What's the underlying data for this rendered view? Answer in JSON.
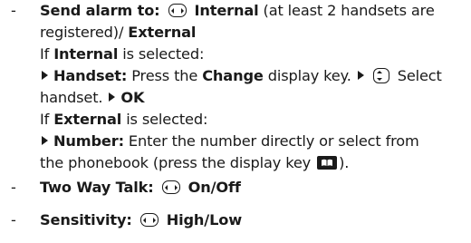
{
  "bullet": "-",
  "items": {
    "send_alarm": {
      "label": "Send alarm to:",
      "internal": "Internal",
      "internal_note": "(at least 2 handsets are",
      "cont": "registered)/",
      "external": "External"
    },
    "if_internal": {
      "prefix": "If",
      "value": "Internal",
      "suffix": "is selected:"
    },
    "handset_step": {
      "label": "Handset:",
      "text1": "Press the",
      "change": "Change",
      "text2": "display key.",
      "select": "Select",
      "cont": "handset.",
      "ok": "OK"
    },
    "if_external": {
      "prefix": "If",
      "value": "External",
      "suffix": "is selected:"
    },
    "number_step": {
      "label": "Number:",
      "text": "Enter the number directly or select from",
      "cont": "the phonebook (press the display key",
      "close": ")."
    },
    "two_way_talk": {
      "label": "Two Way Talk:",
      "value": "On/Off"
    },
    "sensitivity": {
      "label": "Sensitivity:",
      "value": "High/Low"
    }
  },
  "icons": [
    "nav-key-left-right-icon",
    "nav-key-up-down-icon",
    "triangle-arrow-icon",
    "phonebook-key-icon"
  ]
}
